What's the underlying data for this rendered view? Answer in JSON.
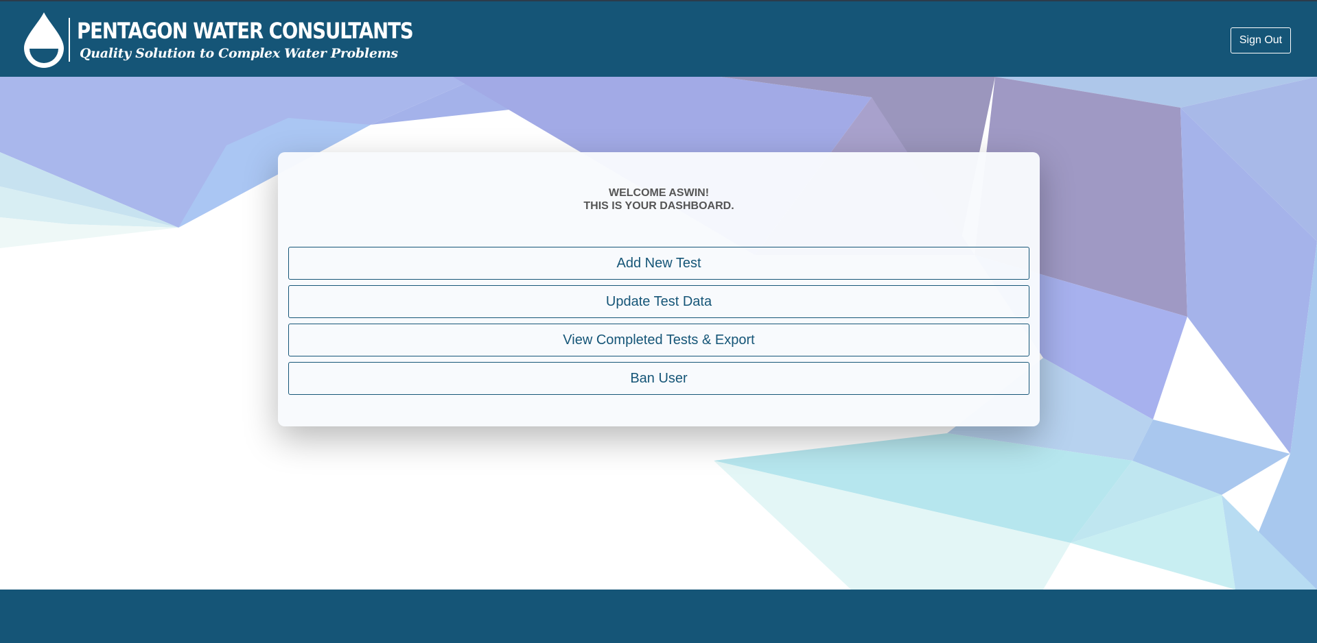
{
  "header": {
    "brand": "PENTAGON WATER CONSULTANTS",
    "tagline": "Quality Solution to Complex Water Problems",
    "logo_icon": "water-drop-icon",
    "signout_label": "Sign Out"
  },
  "dashboard": {
    "welcome_line1": "WELCOME ASWIN!",
    "welcome_line2": "THIS IS YOUR DASHBOARD.",
    "buttons": [
      {
        "label": "Add New Test"
      },
      {
        "label": "Update Test Data"
      },
      {
        "label": "View Completed Tests & Export"
      },
      {
        "label": "Ban User"
      }
    ]
  },
  "colors": {
    "primary": "#155577",
    "header_bg": "#155577",
    "footer_bg": "#155577",
    "welcome_text": "#555555",
    "card_bg": "#f8fafd"
  }
}
